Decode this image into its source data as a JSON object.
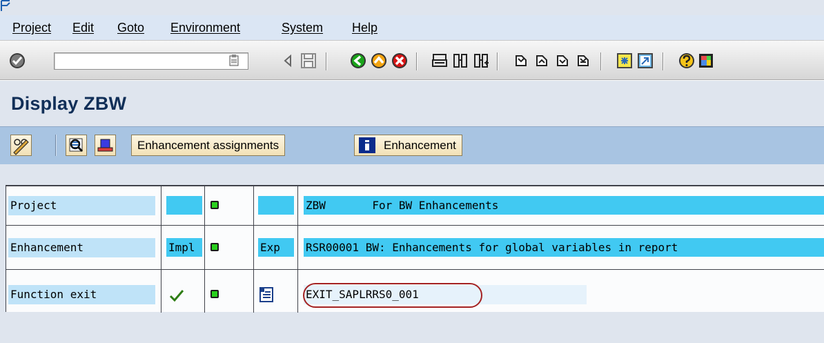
{
  "menu": {
    "items": [
      {
        "label": "Project"
      },
      {
        "label": "Edit"
      },
      {
        "label": "Goto"
      },
      {
        "label": "Environment"
      },
      {
        "label": "System"
      },
      {
        "label": "Help"
      }
    ]
  },
  "toolbar": {
    "command_field_value": "",
    "icons": [
      "enter-icon",
      "command-field-dropdown-icon",
      "back-triangle-icon",
      "save-icon",
      "back-icon",
      "exit-icon",
      "cancel-icon",
      "print-icon",
      "find-icon",
      "find-next-icon",
      "first-page-icon",
      "previous-page-icon",
      "next-page-icon",
      "last-page-icon",
      "create-session-icon",
      "shortcut-icon",
      "help-icon",
      "customize-layout-icon"
    ]
  },
  "title": {
    "text": "Display ZBW"
  },
  "app_toolbar": {
    "enhancement_assignments_label": "Enhancement assignments",
    "enhancement_label": "Enhancement"
  },
  "grid": {
    "rows": [
      {
        "label": "Project",
        "impl": "",
        "exp": "",
        "value": "ZBW       For BW Enhancements"
      },
      {
        "label": "Enhancement",
        "impl": "Impl",
        "exp": "Exp",
        "value": "RSR00001 BW: Enhancements for global variables in report"
      },
      {
        "label": "Function exit",
        "impl": "",
        "exp": "",
        "value": "EXIT_SAPLRRS0_001"
      }
    ]
  },
  "colors": {
    "title": "#112f58",
    "app_toolbar": "#a8c4e2",
    "highlight": "#41c9f2",
    "status_green": "#29d11d",
    "circle": "#a42222"
  }
}
